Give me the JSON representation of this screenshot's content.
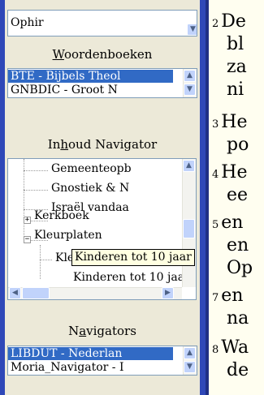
{
  "top_list": {
    "visible_item": "Ophir"
  },
  "dictionaries": {
    "title_underline": "W",
    "title_rest": "oordenboeken",
    "items": [
      "BTE - Bijbels Theol",
      "GNBDIC - Groot N"
    ]
  },
  "content_navigator": {
    "title_pre": "In",
    "title_underline": "h",
    "title_rest": "oud Navigator",
    "items": [
      "Gemeenteopb",
      "Gnostiek & N",
      "Israël vandaa",
      "Kerkboek",
      "Kleurplaten",
      "Kleuters",
      "Kinderen tot 10 jaar"
    ],
    "expanders": [
      "+",
      "−"
    ]
  },
  "tooltip": "Kinderen tot 10 jaar",
  "navigators": {
    "title_pre": "N",
    "title_underline": "a",
    "title_rest": "vigators",
    "items": [
      "LIBDUT - Nederlan",
      "Moria_Navigator - I"
    ]
  },
  "text_pane": {
    "lines": [
      {
        "num": "2",
        "text": "De"
      },
      {
        "num": "",
        "text": "bl"
      },
      {
        "num": "",
        "text": "za"
      },
      {
        "num": "",
        "text": "ni"
      },
      {
        "num": "3",
        "text": "He"
      },
      {
        "num": "",
        "text": "po"
      },
      {
        "num": "4",
        "text": "He"
      },
      {
        "num": "",
        "text": "ee"
      },
      {
        "num": "5",
        "text": "en"
      },
      {
        "num": "",
        "text": "en"
      },
      {
        "num": "",
        "text": "Op"
      },
      {
        "num": "7",
        "text": "en"
      },
      {
        "num": "",
        "text": "na"
      },
      {
        "num": "8",
        "text": "Wa"
      },
      {
        "num": "",
        "text": "de"
      }
    ]
  },
  "icons": {
    "scroll_up": "▲",
    "scroll_down": "▼",
    "scroll_left": "◀",
    "scroll_right": "▶",
    "dropdown": "▼"
  }
}
